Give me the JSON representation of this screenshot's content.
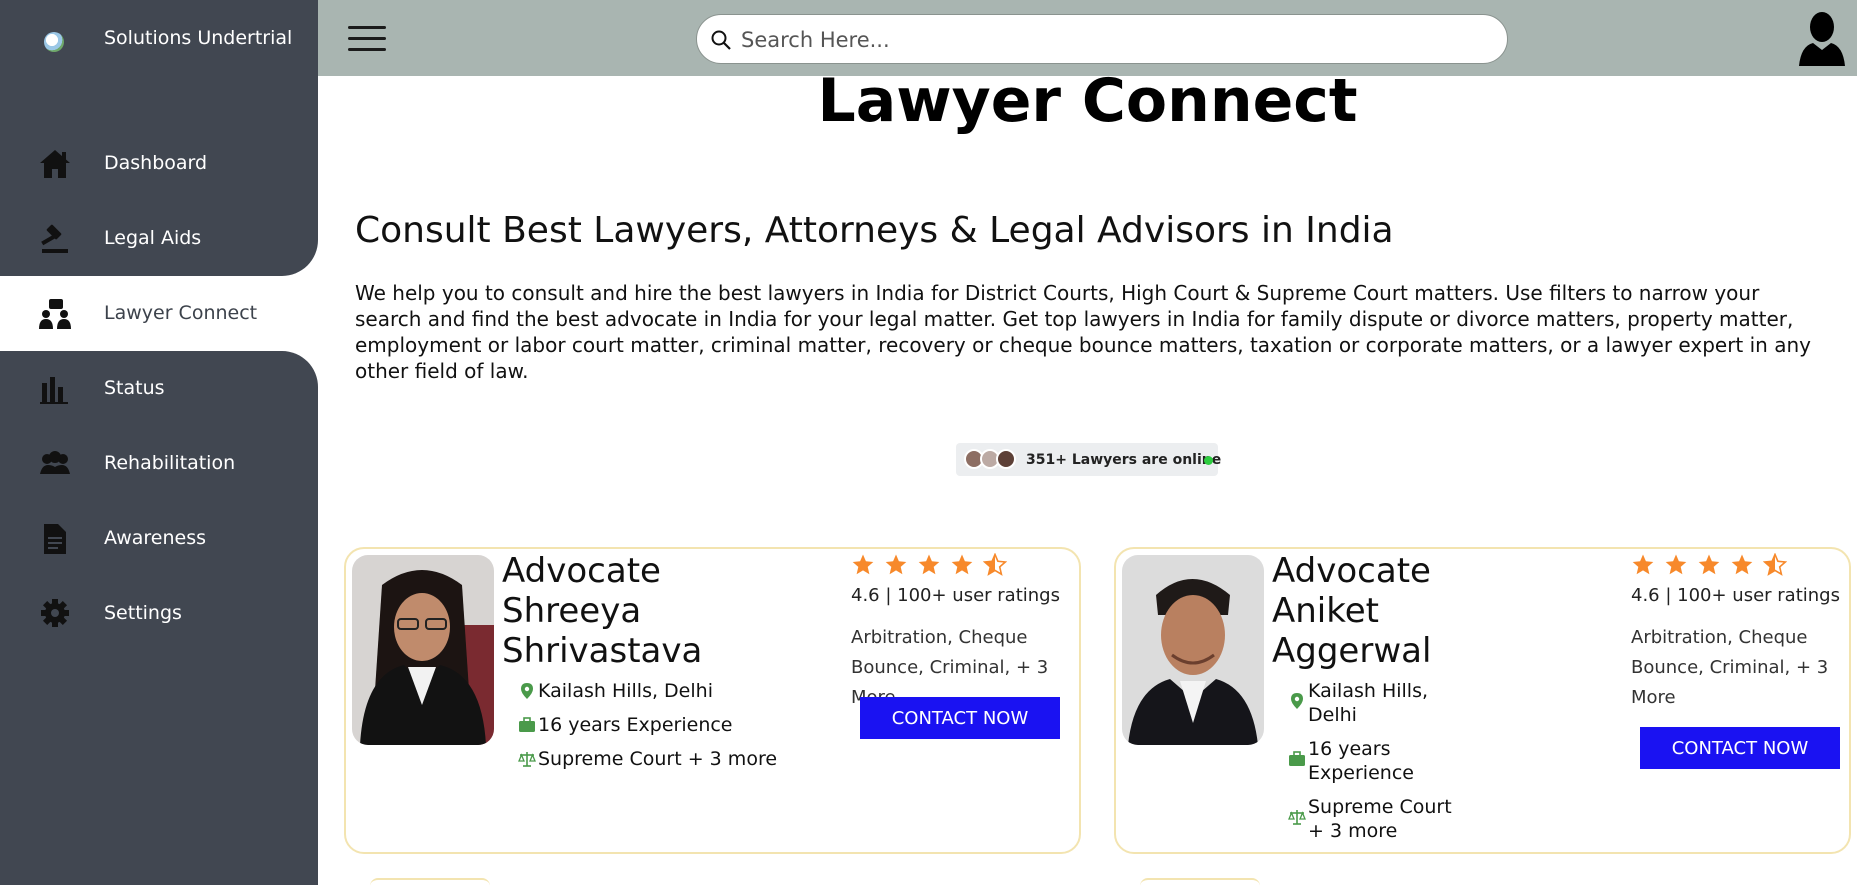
{
  "brand": {
    "name": "Solutions Undertrial"
  },
  "sidebar": {
    "items": [
      {
        "label": "Dashboard",
        "icon": "home-icon"
      },
      {
        "label": "Legal Aids",
        "icon": "gavel-icon"
      },
      {
        "label": "Lawyer Connect",
        "icon": "lawyer-connect-icon",
        "active": true
      },
      {
        "label": "Status",
        "icon": "bar-chart-icon"
      },
      {
        "label": "Rehabilitation",
        "icon": "people-group-icon"
      },
      {
        "label": "Awareness",
        "icon": "document-icon"
      },
      {
        "label": "Settings",
        "icon": "gear-icon"
      }
    ]
  },
  "header": {
    "search_placeholder": "Search Here...",
    "menu_icon": "hamburger-menu-icon",
    "profile_icon": "user-avatar-icon"
  },
  "main": {
    "title": "Lawyer Connect",
    "heading": "Consult Best Lawyers, Attorneys & Legal Advisors in India",
    "intro": "We help you to consult and hire the best lawyers in India for District Courts, High Court & Supreme Court matters. Use filters to narrow your search and find the best advocate in India for your legal matter. Get top lawyers in India for family dispute or divorce matters, property matter, employment or labor court matter, criminal matter, recovery or cheque bounce matters, taxation or corporate matters, or a lawyer expert in any other field of law.",
    "online": {
      "text": "351+ Lawyers are online",
      "status_color": "#2ecc40"
    }
  },
  "lawyers": [
    {
      "name": "Advocate Shreeya Shrivastava",
      "location": "Kailash Hills, Delhi",
      "experience": "16 years Experience",
      "courts": "Supreme Court + 3 more",
      "rating": 4.5,
      "rating_text": "4.6 | 100+ user ratings",
      "practice": "Arbitration, Cheque Bounce, Criminal, + 3 More",
      "contact_label": "CONTACT NOW"
    },
    {
      "name": "Advocate Aniket Aggerwal",
      "location": "Kailash Hills, Delhi",
      "experience": "16 years Experience",
      "courts": "Supreme Court + 3 more",
      "rating": 4.5,
      "rating_text": "4.6 | 100+ user ratings",
      "practice": "Arbitration, Cheque Bounce, Criminal, + 3 More",
      "contact_label": "CONTACT NOW"
    }
  ],
  "colors": {
    "sidebar": "#414751",
    "topbar": "#a9b5b1",
    "accent_button": "#1a12f2",
    "star": "#f7892b",
    "card_border": "#f3e4b0",
    "meta_icon": "#4a9a4a"
  }
}
